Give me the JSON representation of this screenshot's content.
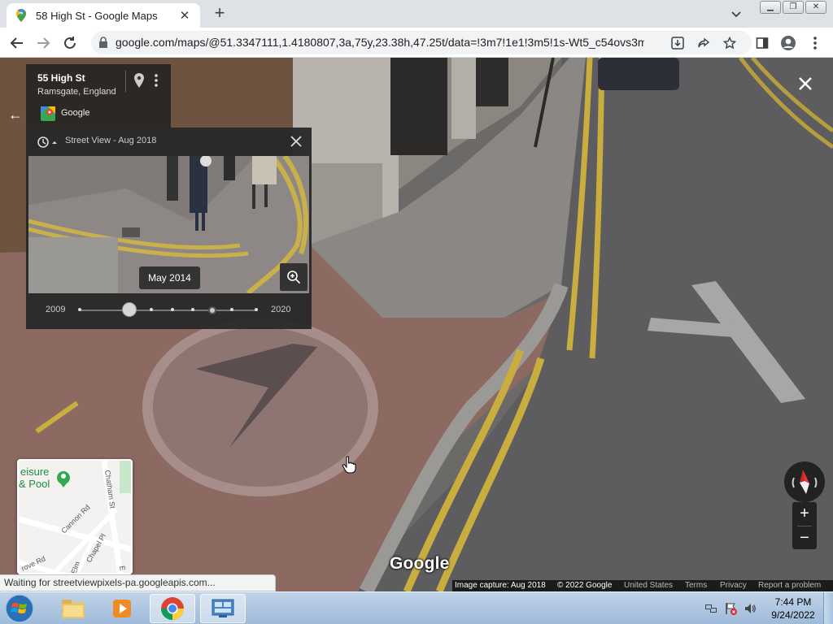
{
  "browser": {
    "tab_title": "58 High St - Google Maps",
    "url": "google.com/maps/@51.3347111,1.4180807,3a,75y,23.38h,47.25t/data=!3m7!1e1!3m5!1s-Wt5_c54ovs3mvm..."
  },
  "info_card": {
    "address_title": "55 High St",
    "address_sub": "Ramsgate, England",
    "provider": "Google"
  },
  "time_machine": {
    "header": "Street View - Aug 2018",
    "selected_date": "May 2014",
    "start_year": "2009",
    "end_year": "2020"
  },
  "minimap": {
    "labels": {
      "leisure1": "eisure",
      "leisure2": "& Pool",
      "cannon": "Cannon Rd",
      "chatham": "Chatham St",
      "chapel": "Chapel Pl",
      "grove": "rove Rd",
      "elm": "Elm",
      "e": "E"
    }
  },
  "watermark": "Google",
  "footer": {
    "capture": "Image capture: Aug 2018",
    "copyright": "© 2022 Google",
    "region": "United States",
    "terms": "Terms",
    "privacy": "Privacy",
    "report": "Report a problem"
  },
  "status_text": "Waiting for streetviewpixels-pa.googleapis.com...",
  "taskbar": {
    "time": "7:44 PM",
    "date": "9/24/2022"
  }
}
